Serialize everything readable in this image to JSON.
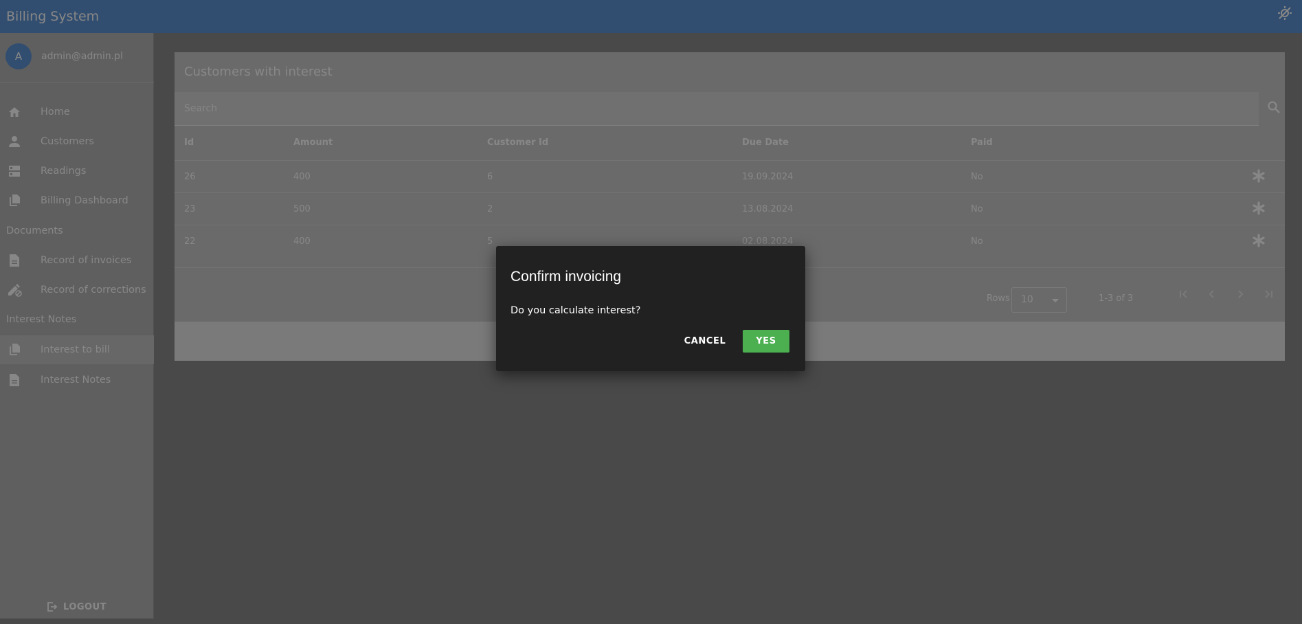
{
  "app": {
    "title": "Billing System"
  },
  "user": {
    "avatar_letter": "A",
    "email": "admin@admin.pl"
  },
  "sidebar": {
    "items": [
      {
        "label": "Home",
        "icon": "home-icon"
      },
      {
        "label": "Customers",
        "icon": "person-icon"
      },
      {
        "label": "Readings",
        "icon": "storage-icon"
      },
      {
        "label": "Billing Dashboard",
        "icon": "copy-icon"
      },
      {
        "label": "Record of invoices",
        "icon": "document-icon"
      },
      {
        "label": "Record of corrections",
        "icon": "edit-off-icon"
      },
      {
        "label": "Interest to bill",
        "icon": "copy-icon",
        "active": true
      },
      {
        "label": "Interest Notes",
        "icon": "document-icon"
      }
    ],
    "sections": {
      "documents": "Documents",
      "interest_notes": "Interest Notes"
    },
    "logout_label": "LOGOUT"
  },
  "main": {
    "card_title": "Customers with interest",
    "search": {
      "placeholder": "Search",
      "value": ""
    },
    "table": {
      "columns": [
        "Id",
        "Amount",
        "Customer Id",
        "Due Date",
        "Paid"
      ],
      "rows": [
        [
          "26",
          "400",
          "6",
          "19.09.2024",
          "No"
        ],
        [
          "23",
          "500",
          "2",
          "13.08.2024",
          "No"
        ],
        [
          "22",
          "400",
          "5",
          "02.08.2024",
          "No"
        ]
      ],
      "row_action_icon": "asterisk-icon"
    },
    "pagination": {
      "rows_label": "Rows",
      "rows_per_page": "10",
      "range": "1-3 of 3"
    }
  },
  "dialog": {
    "title": "Confirm invoicing",
    "message": "Do you calculate interest?",
    "cancel_label": "CANCEL",
    "confirm_label": "YES"
  },
  "colors": {
    "topbar": "#5d91d1",
    "confirm_button": "#4caf50",
    "dialog_bg": "#212121"
  }
}
